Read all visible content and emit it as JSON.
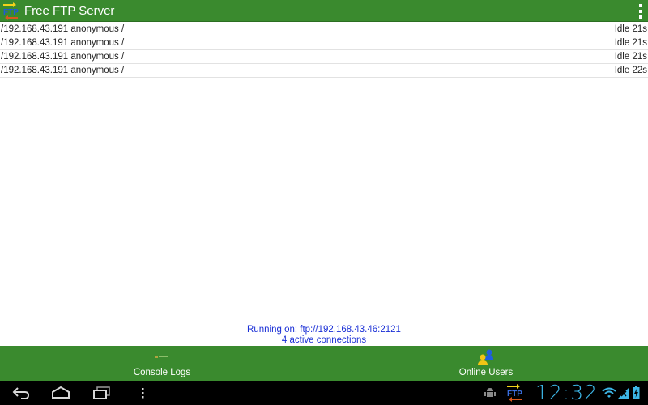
{
  "app": {
    "title": "Free FTP Server",
    "icon": "ftp-app-icon",
    "icon_text": "FTP"
  },
  "connections": [
    {
      "client": "/192.168.43.191 anonymous /",
      "status": "Idle 21s"
    },
    {
      "client": "/192.168.43.191 anonymous /",
      "status": "Idle 21s"
    },
    {
      "client": "/192.168.43.191 anonymous /",
      "status": "Idle 21s"
    },
    {
      "client": "/192.168.43.191 anonymous /",
      "status": "Idle 22s"
    }
  ],
  "status": {
    "running": "Running on: ftp://192.168.43.46:2121",
    "connections": "4 active connections"
  },
  "tabs": [
    {
      "label": "Console Logs",
      "icon": "console-logs-icon"
    },
    {
      "label": "Online Users",
      "icon": "online-users-icon"
    }
  ],
  "system_bar": {
    "time": "12:32",
    "tray_icon_text": "FTP",
    "icons": [
      "back-icon",
      "home-icon",
      "recent-apps-icon",
      "menu-icon",
      "android-debug-icon",
      "ftp-notification-icon",
      "wifi-icon",
      "signal-icon",
      "battery-icon"
    ]
  },
  "colors": {
    "bar_green": "#3a8a2e",
    "status_blue": "#1a2fd6",
    "clock_blue": "#3db7e8"
  }
}
